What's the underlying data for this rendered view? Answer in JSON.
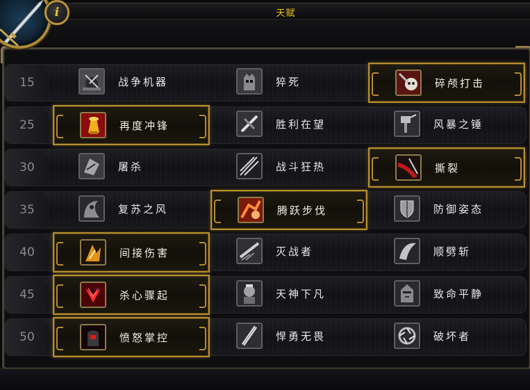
{
  "window": {
    "title": "天赋"
  },
  "header": {
    "portrait_icon": "sword-icon",
    "info_button_glyph": "i"
  },
  "colors": {
    "title_gold": "#f1c21c",
    "selected_border_gold": "#b48d2e",
    "level_gray": "#8b8b8b",
    "talent_text": "#e8e8e8"
  },
  "tiers": [
    {
      "level": "15",
      "selected": 2,
      "talents": [
        {
          "name": "战争机器",
          "icon": "war-machine-icon"
        },
        {
          "name": "猝死",
          "icon": "sudden-death-icon"
        },
        {
          "name": "碎颅打击",
          "icon": "skullsplitter-icon"
        }
      ]
    },
    {
      "level": "25",
      "selected": 0,
      "talents": [
        {
          "name": "再度冲锋",
          "icon": "double-time-icon"
        },
        {
          "name": "胜利在望",
          "icon": "impending-victory-icon"
        },
        {
          "name": "风暴之锤",
          "icon": "storm-bolt-icon"
        }
      ]
    },
    {
      "level": "30",
      "selected": 2,
      "talents": [
        {
          "name": "屠杀",
          "icon": "massacre-icon"
        },
        {
          "name": "战斗狂热",
          "icon": "fervor-of-battle-icon"
        },
        {
          "name": "撕裂",
          "icon": "rend-icon"
        }
      ]
    },
    {
      "level": "35",
      "selected": 1,
      "talents": [
        {
          "name": "复苏之风",
          "icon": "second-wind-icon"
        },
        {
          "name": "腾跃步伐",
          "icon": "bounding-stride-icon"
        },
        {
          "name": "防御姿态",
          "icon": "defensive-stance-icon"
        }
      ]
    },
    {
      "level": "40",
      "selected": 0,
      "talents": [
        {
          "name": "间接伤害",
          "icon": "collateral-damage-icon"
        },
        {
          "name": "灭战者",
          "icon": "warbreaker-icon"
        },
        {
          "name": "顺劈斩",
          "icon": "cleave-icon"
        }
      ]
    },
    {
      "level": "45",
      "selected": 0,
      "talents": [
        {
          "name": "杀心骤起",
          "icon": "in-for-the-kill-icon"
        },
        {
          "name": "天神下凡",
          "icon": "avatar-icon"
        },
        {
          "name": "致命平静",
          "icon": "deadly-calm-icon"
        }
      ]
    },
    {
      "level": "50",
      "selected": 0,
      "talents": [
        {
          "name": "愤怒掌控",
          "icon": "anger-management-icon"
        },
        {
          "name": "悍勇无畏",
          "icon": "dreadnaught-icon"
        },
        {
          "name": "破坏者",
          "icon": "ravager-icon"
        }
      ]
    }
  ]
}
